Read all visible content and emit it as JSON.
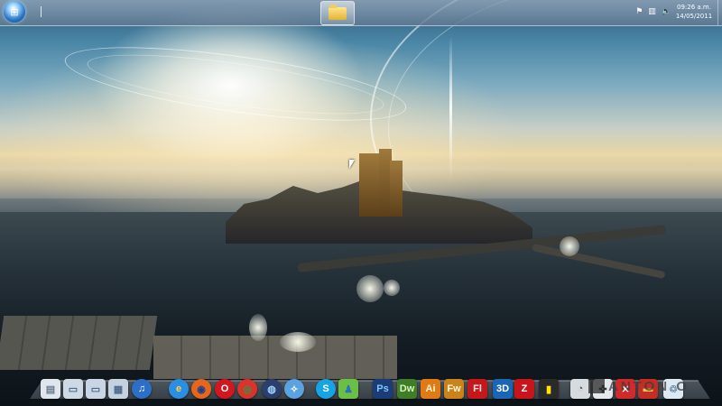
{
  "taskbar": {
    "start_button": {
      "icon": "windows-start-orb"
    },
    "open_windows": [
      {
        "icon": "folder-icon",
        "app": "Windows Explorer"
      }
    ],
    "tray": {
      "icons": [
        "flag-icon",
        "network-icon",
        "volume-icon"
      ],
      "time": "09:26 a.m.",
      "date": "14/05/2011"
    }
  },
  "dock": {
    "items": [
      {
        "name": "documents",
        "label": "",
        "color": "#dfe6ee",
        "fg": "#6b7b8c",
        "glyph": "▤"
      },
      {
        "name": "folder-1",
        "label": "",
        "color": "#cfd9e6",
        "fg": "#4e6a8c",
        "glyph": "▭"
      },
      {
        "name": "folder-2",
        "label": "",
        "color": "#c9d5e4",
        "fg": "#4e6a8c",
        "glyph": "▭"
      },
      {
        "name": "folder-3",
        "label": "",
        "color": "#c4d1e0",
        "fg": "#4e6a8c",
        "glyph": "▦"
      },
      {
        "name": "itunes",
        "label": "",
        "color": "#2d6fc7",
        "fg": "#ffffff",
        "glyph": "♫"
      },
      {
        "name": "internet-explorer",
        "label": "",
        "color": "#2c8ee0",
        "fg": "#ffd24a",
        "glyph": "e"
      },
      {
        "name": "firefox",
        "label": "",
        "color": "#e8661c",
        "fg": "#1c3f8f",
        "glyph": "◉"
      },
      {
        "name": "opera",
        "label": "",
        "color": "#d4171e",
        "fg": "#ffffff",
        "glyph": "O"
      },
      {
        "name": "chrome",
        "label": "",
        "color": "#d8342c",
        "fg": "#2a9c48",
        "glyph": "◎"
      },
      {
        "name": "browser-globe",
        "label": "",
        "color": "#2c3e6c",
        "fg": "#9fd0ff",
        "glyph": "◍"
      },
      {
        "name": "safari",
        "label": "",
        "color": "#5aa2e0",
        "fg": "#ffffff",
        "glyph": "✧"
      },
      {
        "name": "skype",
        "label": "",
        "color": "#16a4e4",
        "fg": "#ffffff",
        "glyph": "S"
      },
      {
        "name": "messenger",
        "label": "",
        "color": "#6bbf45",
        "fg": "#2a6fc0",
        "glyph": "♟"
      },
      {
        "name": "photoshop",
        "label": "Ps",
        "color": "#1c3c78",
        "fg": "#7fc6ff",
        "glyph": ""
      },
      {
        "name": "dreamweaver",
        "label": "Dw",
        "color": "#3f7d2a",
        "fg": "#d5f5b4",
        "glyph": ""
      },
      {
        "name": "illustrator",
        "label": "Ai",
        "color": "#e07a12",
        "fg": "#fff3d6",
        "glyph": ""
      },
      {
        "name": "fireworks",
        "label": "Fw",
        "color": "#c9831a",
        "fg": "#fff6e0",
        "glyph": ""
      },
      {
        "name": "flash",
        "label": "Fl",
        "color": "#c4181c",
        "fg": "#ffe3e3",
        "glyph": ""
      },
      {
        "name": "3ds-max",
        "label": "3D",
        "color": "#1a66b5",
        "fg": "#ffffff",
        "glyph": ""
      },
      {
        "name": "filezilla",
        "label": "Z",
        "color": "#c8141a",
        "fg": "#ffffff",
        "glyph": ""
      },
      {
        "name": "usb-drive",
        "label": "",
        "color": "#2a2a2a",
        "fg": "#ffe600",
        "glyph": "▮"
      },
      {
        "name": "satellite-dish",
        "label": "",
        "color": "#d6dbe0",
        "fg": "#555",
        "glyph": "◔"
      },
      {
        "name": "game-controller",
        "label": "",
        "color": "#e4e8ec",
        "fg": "#333",
        "glyph": "✜"
      },
      {
        "name": "tools-x",
        "label": "",
        "color": "#d12a2a",
        "fg": "#ffffff",
        "glyph": "✕"
      },
      {
        "name": "toolbox",
        "label": "",
        "color": "#c32d23",
        "fg": "#f3c14a",
        "glyph": "▬"
      },
      {
        "name": "recycle-bin",
        "label": "",
        "color": "#dce8f2",
        "fg": "#5d7f9c",
        "glyph": "♲"
      }
    ]
  },
  "watermark": {
    "text": "ANTON O"
  }
}
